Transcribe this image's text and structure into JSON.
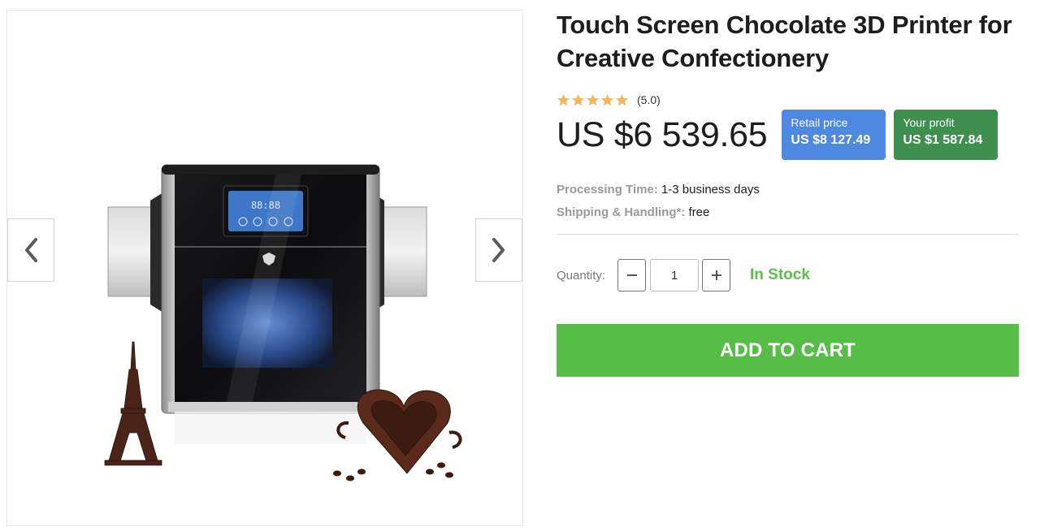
{
  "gallery": {
    "prev_icon": "chevron-left-icon",
    "next_icon": "chevron-right-icon",
    "image": {
      "display_text": "88:88"
    }
  },
  "product": {
    "title": "Touch Screen Chocolate 3D Printer for Creative Confectionery",
    "rating": {
      "stars": 5,
      "max_stars": 5,
      "text": "(5.0)",
      "star_color": "#f0b85a"
    },
    "price": "US $6 539.65",
    "retail": {
      "label": "Retail price",
      "value": "US $8 127.49",
      "color": "#4e88e0"
    },
    "profit": {
      "label": "Your profit",
      "value": "US $1 587.84",
      "color": "#3f8f50"
    },
    "processing": {
      "label": "Processing Time:",
      "value": "1-3 business days"
    },
    "shipping": {
      "label": "Shipping & Handling*:",
      "value": "free"
    },
    "quantity": {
      "label": "Quantity:",
      "value": "1",
      "minus_icon": "minus-icon",
      "plus_icon": "plus-icon"
    },
    "stock_status": "In Stock",
    "add_to_cart": "ADD TO CART",
    "accent_green": "#56bd46"
  }
}
